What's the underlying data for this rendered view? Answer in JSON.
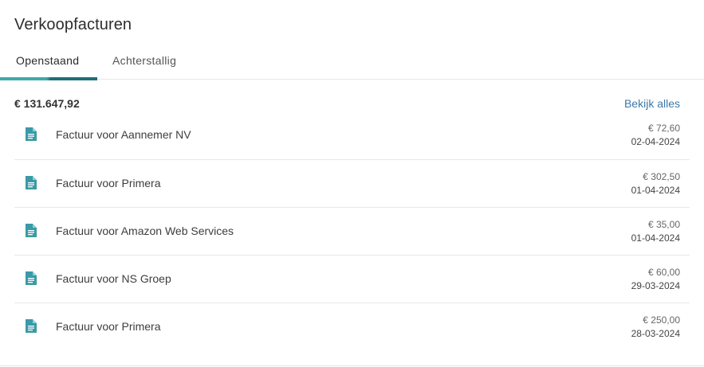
{
  "widget": {
    "title": "Verkoopfacturen",
    "tabs": [
      {
        "label": "Openstaand",
        "active": true
      },
      {
        "label": "Achterstallig",
        "active": false
      }
    ],
    "total": "€ 131.647,92",
    "view_all_label": "Bekijk alles",
    "accent_color": "#3fa9a9",
    "accent_dark": "#1e6f78",
    "link_color": "#3b78a8",
    "invoices": [
      {
        "icon": "document-icon",
        "label": "Factuur voor Aannemer NV",
        "amount": "€ 72,60",
        "date": "02-04-2024"
      },
      {
        "icon": "document-icon",
        "label": "Factuur voor Primera",
        "amount": "€ 302,50",
        "date": "01-04-2024"
      },
      {
        "icon": "document-icon",
        "label": "Factuur voor Amazon Web Services",
        "amount": "€ 35,00",
        "date": "01-04-2024"
      },
      {
        "icon": "document-icon",
        "label": "Factuur voor NS Groep",
        "amount": "€ 60,00",
        "date": "29-03-2024"
      },
      {
        "icon": "document-icon",
        "label": "Factuur voor Primera",
        "amount": "€ 250,00",
        "date": "28-03-2024"
      }
    ]
  }
}
